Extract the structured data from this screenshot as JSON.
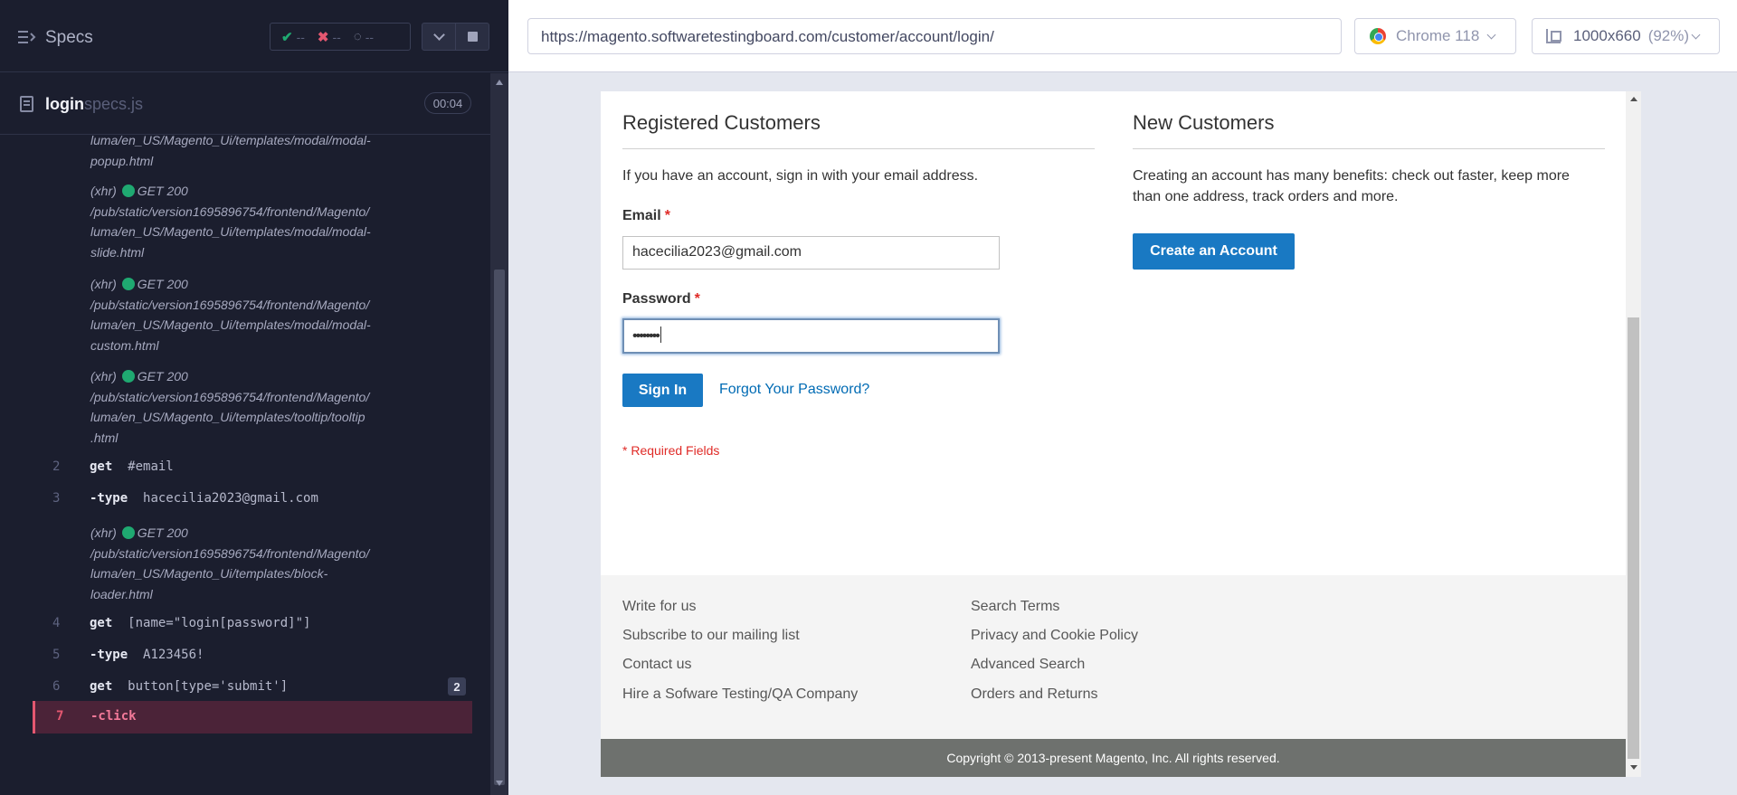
{
  "reporter": {
    "specs_label": "Specs",
    "stats": {
      "passed": "--",
      "failed": "--",
      "pending": "--"
    },
    "spec": {
      "name": "login",
      "ext": "specs.js",
      "time": "00:04"
    },
    "log": [
      {
        "kind": "xhr-tail",
        "lines": [
          "luma/en_US/Magento_Ui/templates/modal/modal-",
          "popup.html"
        ]
      },
      {
        "kind": "xhr",
        "prefix": "(xhr)",
        "status": "GET 200",
        "lines": [
          "/pub/static/version1695896754/frontend/Magento/",
          "luma/en_US/Magento_Ui/templates/modal/modal-",
          "slide.html"
        ]
      },
      {
        "kind": "xhr",
        "prefix": "(xhr)",
        "status": "GET 200",
        "lines": [
          "/pub/static/version1695896754/frontend/Magento/",
          "luma/en_US/Magento_Ui/templates/modal/modal-",
          "custom.html"
        ]
      },
      {
        "kind": "xhr",
        "prefix": "(xhr)",
        "status": "GET 200",
        "lines": [
          "/pub/static/version1695896754/frontend/Magento/",
          "luma/en_US/Magento_Ui/templates/tooltip/tooltip",
          ".html"
        ]
      },
      {
        "kind": "cmd",
        "num": "2",
        "cmd": "get",
        "arg": "#email"
      },
      {
        "kind": "cmd",
        "num": "3",
        "cmd": "-type",
        "arg": "hacecilia2023@gmail.com"
      },
      {
        "kind": "xhr",
        "prefix": "(xhr)",
        "status": "GET 200",
        "lines": [
          "/pub/static/version1695896754/frontend/Magento/",
          "luma/en_US/Magento_Ui/templates/block-",
          "loader.html"
        ]
      },
      {
        "kind": "cmd",
        "num": "4",
        "cmd": "get",
        "arg": "[name=\"login[password]\"]"
      },
      {
        "kind": "cmd",
        "num": "5",
        "cmd": "-type",
        "arg": "A123456!"
      },
      {
        "kind": "cmd",
        "num": "6",
        "cmd": "get",
        "arg": "button[type='submit']",
        "badge": "2"
      },
      {
        "kind": "active",
        "num": "7",
        "cmd": "-click"
      }
    ]
  },
  "aut": {
    "url": "https://magento.softwaretestingboard.com/customer/account/login/",
    "browser": "Chrome 118",
    "viewport": "1000x660",
    "zoom": "(92%)"
  },
  "page": {
    "registered": {
      "title": "Registered Customers",
      "intro": "If you have an account, sign in with your email address.",
      "email_label": "Email",
      "email_value": "hacecilia2023@gmail.com",
      "password_label": "Password",
      "password_value": "••••••••",
      "required_mark": "*",
      "sign_in": "Sign In",
      "forgot": "Forgot Your Password?",
      "required_note": "* Required Fields"
    },
    "new_customers": {
      "title": "New Customers",
      "intro_line1": "Creating an account has many benefits: check out faster, keep more",
      "intro_line2": "than one address, track orders and more.",
      "create": "Create an Account"
    },
    "footer": {
      "col1": [
        "Write for us",
        "Subscribe to our mailing list",
        "Contact us",
        "Hire a Sofware Testing/QA Company"
      ],
      "col2": [
        "Search Terms",
        "Privacy and Cookie Policy",
        "Advanced Search",
        "Orders and Returns"
      ],
      "copyright": "Copyright © 2013-present Magento, Inc. All rights reserved."
    }
  }
}
